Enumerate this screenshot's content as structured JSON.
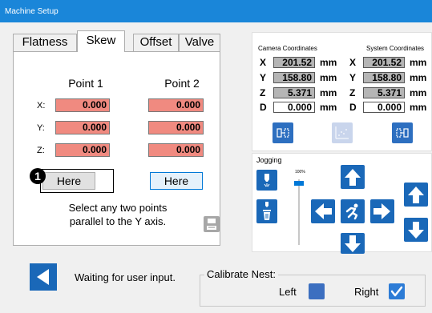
{
  "window": {
    "title": "Machine Setup"
  },
  "tabs": [
    {
      "label": "Flatness",
      "active": false
    },
    {
      "label": "Skew",
      "active": true
    },
    {
      "label": "Offset",
      "active": false
    },
    {
      "label": "Valve",
      "active": false
    }
  ],
  "skew": {
    "point1_heading": "Point 1",
    "point2_heading": "Point 2",
    "rows": [
      {
        "axis": "X:",
        "point1": "0.000",
        "point2": "0.000"
      },
      {
        "axis": "Y:",
        "point1": "0.000",
        "point2": "0.000"
      },
      {
        "axis": "Z:",
        "point1": "0.000",
        "point2": "0.000"
      }
    ],
    "here1_label": "Here",
    "here2_label": "Here",
    "badge": "1",
    "instruction_line1": "Select any two points",
    "instruction_line2": "parallel to the Y axis."
  },
  "coordinates": {
    "camera_title": "Camera Coordinates",
    "system_title": "System Coordinates",
    "rows": [
      {
        "axis": "X",
        "camera": "201.52",
        "system": "201.52",
        "unit": "mm"
      },
      {
        "axis": "Y",
        "camera": "158.80",
        "system": "158.80",
        "unit": "mm"
      },
      {
        "axis": "Z",
        "camera": "5.371",
        "system": "5.371",
        "unit": "mm"
      },
      {
        "axis": "D",
        "camera": "0.000",
        "system": "0.000",
        "unit": "mm"
      }
    ]
  },
  "jogging": {
    "title": "Jogging",
    "speed_label": "100%",
    "speed_value_fraction": 0.97
  },
  "status": {
    "message": "Waiting for user input."
  },
  "calibrate_nest": {
    "legend": "Calibrate Nest:",
    "left_label": "Left",
    "left_checked": false,
    "right_label": "Right",
    "right_checked": true
  },
  "colors": {
    "accent": "#1a68b8",
    "titlebar": "#1a86d9",
    "point_field": "#f08a80",
    "coord_field": "#b5b5b5"
  }
}
